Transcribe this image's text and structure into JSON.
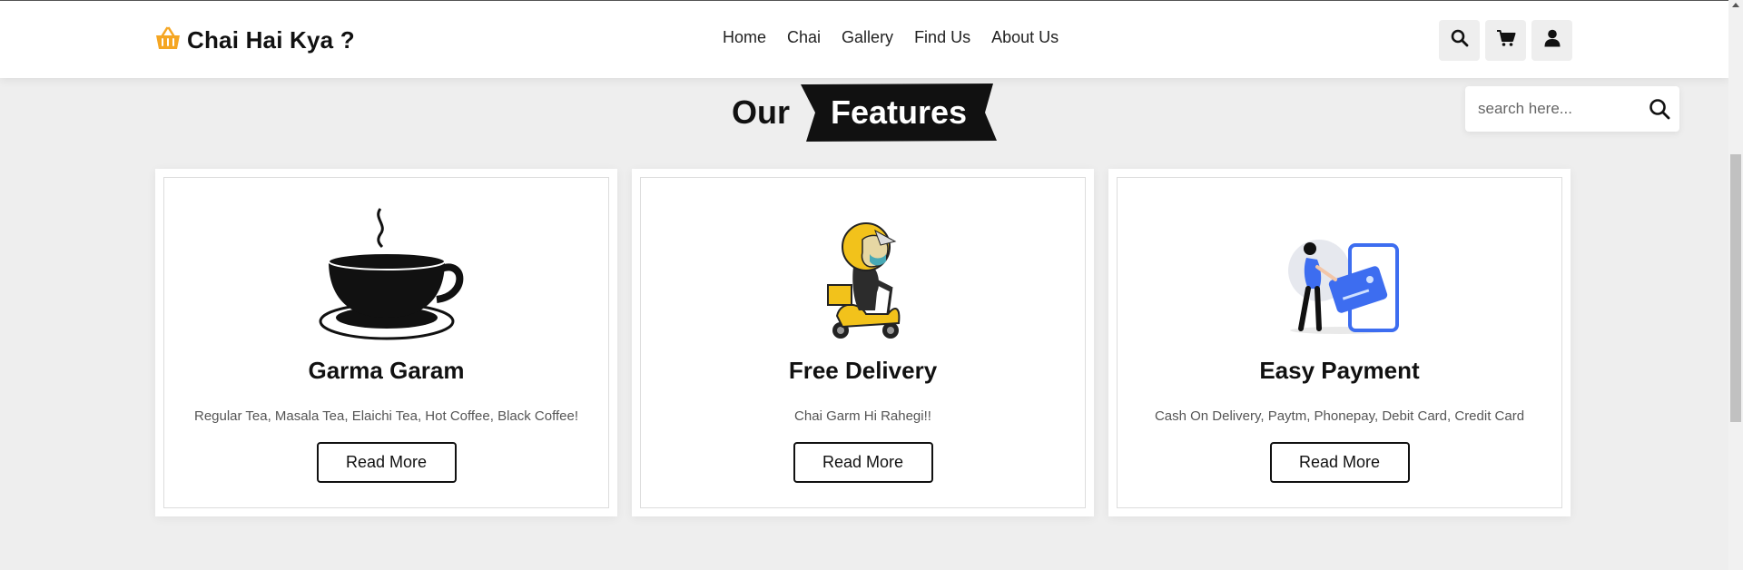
{
  "header": {
    "brand": "Chai Hai Kya ?",
    "nav": [
      "Home",
      "Chai",
      "Gallery",
      "Find Us",
      "About Us"
    ],
    "icons": [
      "search-icon",
      "cart-icon",
      "user-icon"
    ]
  },
  "section": {
    "heading_plain": "Our",
    "heading_highlight": "Features"
  },
  "search": {
    "placeholder": "search here..."
  },
  "features": [
    {
      "title": "Garma Garam",
      "text": "Regular Tea, Masala Tea, Elaichi Tea, Hot Coffee, Black Coffee!",
      "button": "Read More",
      "image": "tea-cup-image"
    },
    {
      "title": "Free Delivery",
      "text": "Chai Garm Hi Rahegi!!",
      "button": "Read More",
      "image": "delivery-scooter-image"
    },
    {
      "title": "Easy Payment",
      "text": "Cash On Delivery, Paytm, Phonepay, Debit Card, Credit Card",
      "button": "Read More",
      "image": "payment-card-image"
    }
  ],
  "colors": {
    "background": "#eeeeee",
    "accent": "#f5a623",
    "heading_banner": "#111111"
  }
}
